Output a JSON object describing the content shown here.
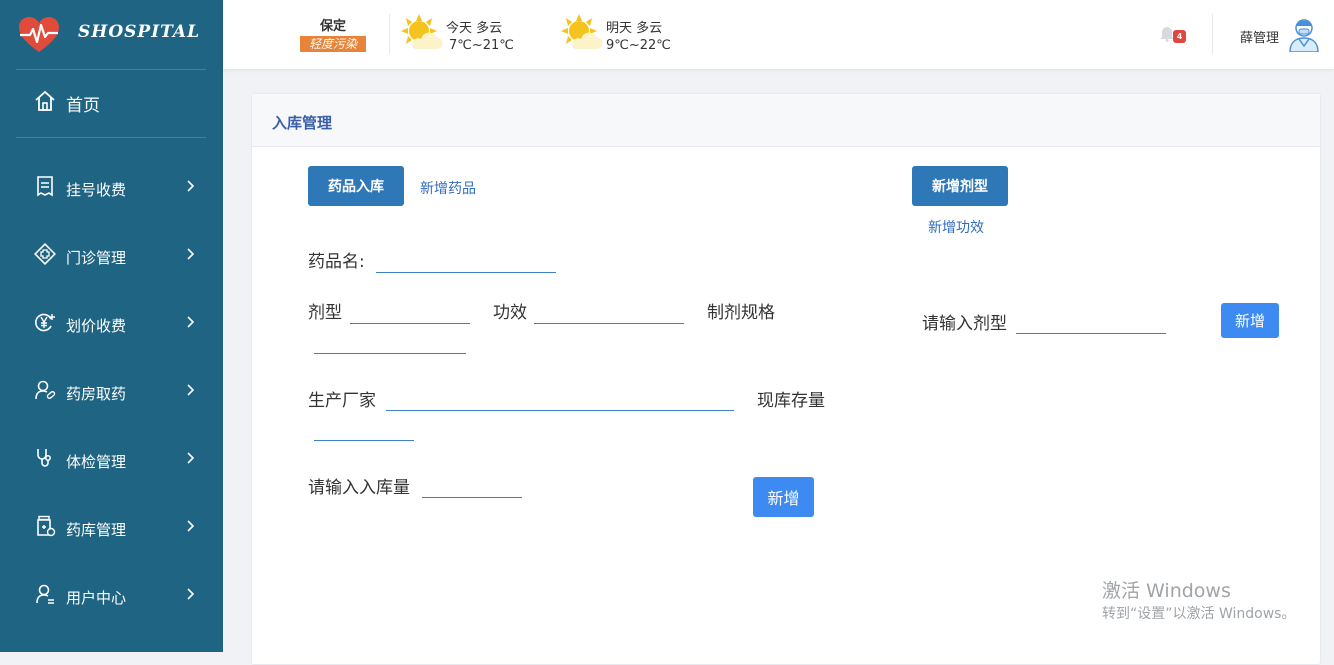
{
  "app": {
    "logo_text": "SHOSPITAL"
  },
  "sidebar": {
    "home_label": "首页",
    "items": [
      {
        "label": "挂号收费",
        "icon": "receipt-icon"
      },
      {
        "label": "门诊管理",
        "icon": "medical-cross-icon"
      },
      {
        "label": "划价收费",
        "icon": "yen-coin-icon"
      },
      {
        "label": "药房取药",
        "icon": "user-pill-icon"
      },
      {
        "label": "体检管理",
        "icon": "stethoscope-icon"
      },
      {
        "label": "药库管理",
        "icon": "medicine-box-icon"
      },
      {
        "label": "用户中心",
        "icon": "user-icon"
      }
    ]
  },
  "header": {
    "city": "保定",
    "aqi": "轻度污染",
    "today": {
      "line1": "今天  多云",
      "line2": "7℃~21℃"
    },
    "tomorrow": {
      "line1": "明天  多云",
      "line2": "9℃~22℃"
    },
    "notification_count": "4",
    "user_name": "薛管理"
  },
  "panel": {
    "title": "入库管理",
    "tab_active": "药品入库",
    "tab_link": "新增药品",
    "add_dosage_button": "新增剂型",
    "add_efficacy_link": "新增功效"
  },
  "form": {
    "drug_name_label": "药品名:",
    "dosage_label": "剂型",
    "efficacy_label": "功效",
    "spec_label": "制剂规格",
    "manufacturer_label": "生产厂家",
    "stock_label": "现库存量",
    "qty_label": "请输入入库量",
    "submit_label": "新增"
  },
  "dosage_form": {
    "label": "请输入剂型",
    "button": "新增"
  },
  "watermark": {
    "line1": "激活 Windows",
    "line2": "转到“设置”以激活 Windows。"
  },
  "colors": {
    "sidebar_bg": "#1f6482",
    "primary_dark": "#2f78b7",
    "primary": "#3d8bf2",
    "aqi_badge": "#e8843a",
    "badge_red": "#e0483f"
  }
}
